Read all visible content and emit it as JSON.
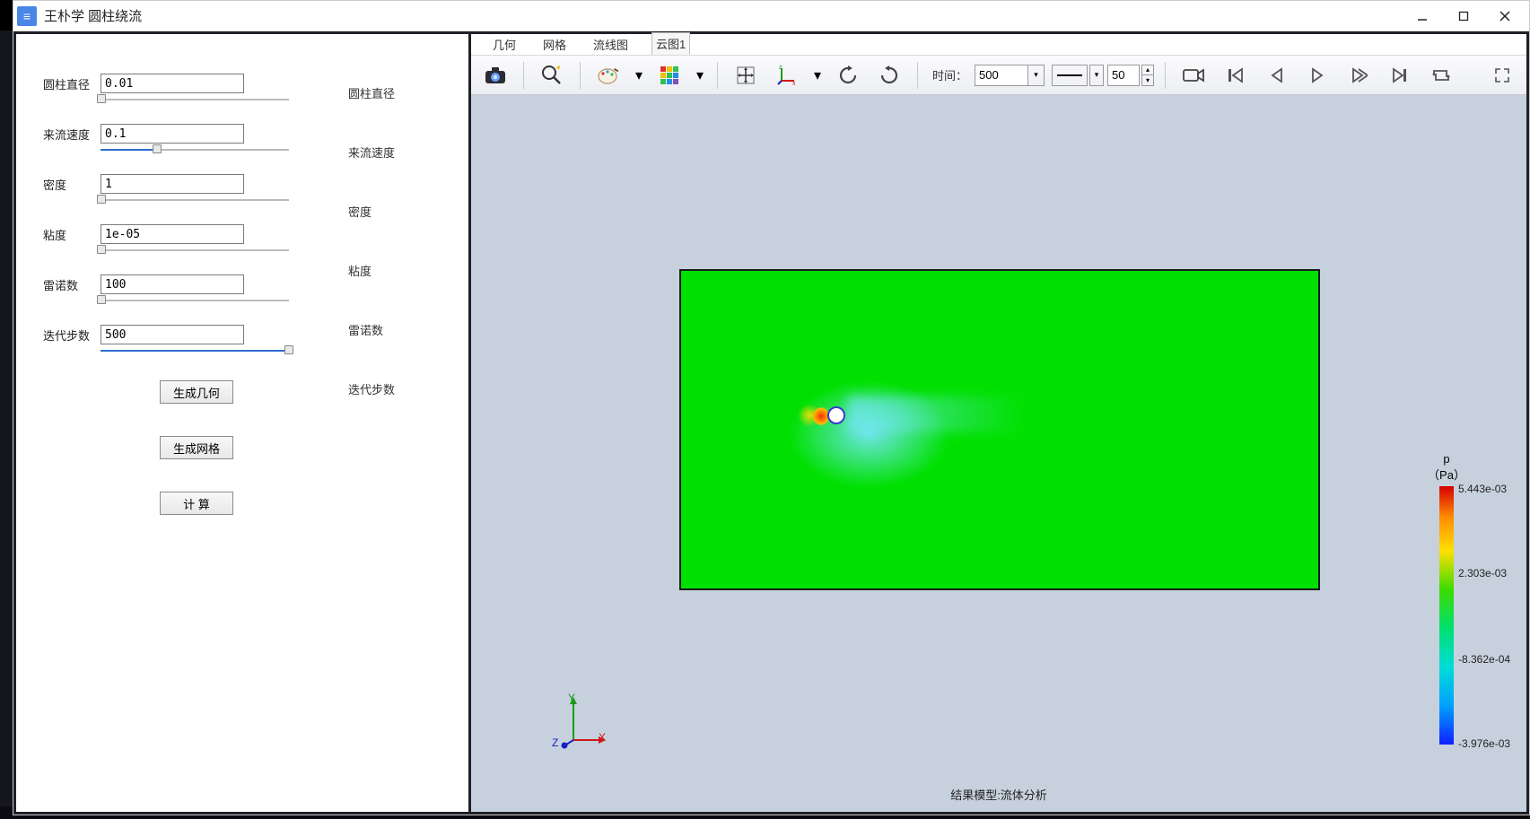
{
  "title": "王朴学  圆柱绕流",
  "params": {
    "diameter": {
      "label": "圆柱直径",
      "value": "0.01",
      "side": "圆柱直径",
      "fill_pct": 0
    },
    "velocity": {
      "label": "来流速度",
      "value": "0.1",
      "side": "来流速度",
      "fill_pct": 30
    },
    "density": {
      "label": "密度",
      "value": "1",
      "side": "密度",
      "fill_pct": 0
    },
    "viscosity": {
      "label": "粘度",
      "value": "1e-05",
      "side": "粘度",
      "fill_pct": 0
    },
    "reynolds": {
      "label": "雷诺数",
      "value": "100",
      "side": "雷诺数",
      "fill_pct": 0
    },
    "steps": {
      "label": "迭代步数",
      "value": "500",
      "side": "迭代步数",
      "fill_pct": 100
    }
  },
  "buttons": {
    "gen_geom": "生成几何",
    "gen_mesh": "生成网格",
    "compute": "计 算"
  },
  "tabs": {
    "geometry": "几何",
    "mesh": "网格",
    "streamline": "流线图",
    "contour": "云图1"
  },
  "toolbar": {
    "time_label": "时间：",
    "time_value": "500",
    "thickness_value": "50"
  },
  "legend": {
    "variable": "p",
    "unit": "（Pa）",
    "ticks": {
      "max": "5.443e-03",
      "mid1": "2.303e-03",
      "mid2": "-8.362e-04",
      "min": "-3.976e-03"
    }
  },
  "axes": {
    "x": "X",
    "y": "Y",
    "z": "Z"
  },
  "status": "结果模型:流体分析",
  "icons": {
    "camera": "camera-icon",
    "zoom": "zoom-icon",
    "palette": "palette-icon",
    "colormap": "colormap-icon",
    "move": "move-icon",
    "axes": "axes-icon",
    "rotate_cw": "rotate-cw-icon",
    "rotate_ccw": "rotate-ccw-icon",
    "rec": "record-icon",
    "first": "first-frame-icon",
    "prev": "prev-frame-icon",
    "play": "play-icon",
    "next": "next-frame-icon",
    "last": "last-frame-icon",
    "loop": "loop-icon",
    "expand": "expand-icon"
  }
}
